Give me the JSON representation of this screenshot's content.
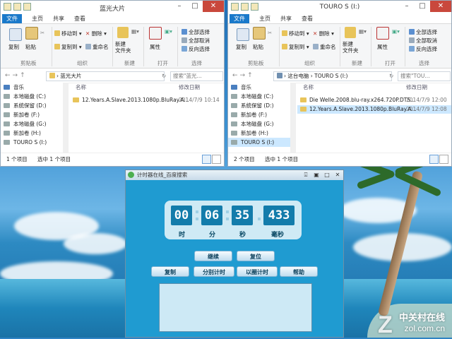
{
  "explorer_left": {
    "title": "蓝光大片",
    "tabs": [
      "文件",
      "主页",
      "共享",
      "查看"
    ],
    "ribbon": {
      "copy": "复制",
      "paste": "粘贴",
      "move_to": "移动到",
      "copy_to": "复制到",
      "delete": "删除",
      "rename": "重命名",
      "new_folder": "新建\n文件夹",
      "properties": "属性",
      "select_all": "全部选择",
      "select_none": "全部取消",
      "invert": "反向选择",
      "groups": [
        "剪贴板",
        "组织",
        "新建",
        "打开",
        "选择"
      ]
    },
    "address": "蓝光大片",
    "search_placeholder": "搜索\"蓝光...",
    "nav": [
      "音乐",
      "本地磁盘 (C:)",
      "系统保留 (D:)",
      "新加卷 (F:)",
      "本地磁盘 (G:)",
      "新加卷 (H:)",
      "TOURO S (I:)"
    ],
    "columns": [
      "名称",
      "修改日期"
    ],
    "files": [
      {
        "name": "12.Years.A.Slave.2013.1080p.BluRay.A...",
        "date": "2014/7/9 10:14",
        "selected": false
      }
    ],
    "status_items": "1 个项目",
    "status_selected": "选中 1 个项目"
  },
  "explorer_right": {
    "title": "TOURO S (I:)",
    "tabs": [
      "文件",
      "主页",
      "共享",
      "查看"
    ],
    "ribbon": {
      "copy": "复制",
      "paste": "粘贴",
      "move_to": "移动到",
      "copy_to": "复制到",
      "delete": "删除",
      "rename": "重命名",
      "new_folder": "新建\n文件夹",
      "properties": "属性",
      "select_all": "全部选择",
      "select_none": "全部取消",
      "invert": "反向选择",
      "groups": [
        "剪贴板",
        "组织",
        "新建",
        "打开",
        "选择"
      ]
    },
    "address": "这台电脑 › TOURO S (I:)",
    "search_placeholder": "搜索\"TOU...",
    "nav": [
      "音乐",
      "本地磁盘 (C:)",
      "系统保留 (D:)",
      "新加卷 (F:)",
      "本地磁盘 (G:)",
      "新加卷 (H:)",
      "TOURO S (I:)"
    ],
    "columns": [
      "名称",
      "修改日期"
    ],
    "files": [
      {
        "name": "Die Welle.2008.blu-ray.x264.720P.DTS...",
        "date": "2014/7/9 12:00",
        "selected": false
      },
      {
        "name": "12.Years.A.Slave.2013.1080p.BluRay.A...",
        "date": "2014/7/9 12:08",
        "selected": true
      }
    ],
    "status_items": "2 个项目",
    "status_selected": "选中 1 个项目"
  },
  "timer": {
    "title": "计时器在线_百度搜索",
    "hours": "00",
    "minutes": "06",
    "seconds": "35",
    "millis": "433",
    "units": [
      "时",
      "分",
      "秒",
      "毫秒"
    ],
    "buttons_row1": [
      "继续",
      "复位"
    ],
    "buttons_row2": [
      "复制",
      "分别计时",
      "以圈计时",
      "帮助"
    ]
  },
  "watermark": {
    "brand": "中关村在线",
    "url": "zol.com.cn",
    "logo": "Z"
  }
}
